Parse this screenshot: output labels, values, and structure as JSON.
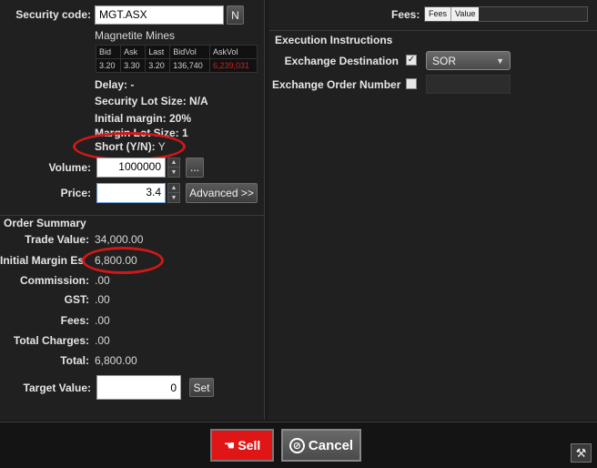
{
  "security": {
    "code_label": "Security code:",
    "code_value": "MGT.ASX",
    "n_button": "N",
    "name": "Magnetite Mines"
  },
  "market": {
    "headers": [
      "Bid",
      "Ask",
      "Last",
      "BidVol",
      "AskVol"
    ],
    "row": [
      "3.20",
      "3.30",
      "3.20",
      "136,740",
      "6,239,031"
    ],
    "askvol_color": "#d22020"
  },
  "info": {
    "delay": "Delay: -",
    "lot_size": "Security Lot Size: N/A",
    "initial_margin": "Initial margin: 20%",
    "margin_lot_size": "Margin Lot Size: 1",
    "short_label": "Short (Y/N):",
    "short_value": "Y"
  },
  "order": {
    "volume_label": "Volume:",
    "volume_value": "1000000",
    "ellipsis_button": "...",
    "price_label": "Price:",
    "price_value": "3.4",
    "advanced_button": "Advanced >>"
  },
  "summary": {
    "title": "Order Summary",
    "trade_value_label": "Trade Value:",
    "trade_value": "34,000.00",
    "initial_margin_label": "Initial Margin Es",
    "initial_margin_value": "6,800.00",
    "commission_label": "Commission:",
    "commission_value": ".00",
    "gst_label": "GST:",
    "gst_value": ".00",
    "fees_label": "Fees:",
    "fees_value": ".00",
    "total_charges_label": "Total Charges:",
    "total_charges_value": ".00",
    "total_label": "Total:",
    "total_value": "6,800.00",
    "target_label": "Target Value:",
    "target_value": "0",
    "set_button": "Set"
  },
  "right": {
    "fees_label": "Fees:",
    "fees_tab": "Fees",
    "value_tab": "Value",
    "exec_title": "Execution Instructions",
    "exchange_dest_label": "Exchange Destination",
    "exchange_dest_checked": true,
    "exchange_dest_value": "SOR",
    "exchange_order_label": "Exchange Order Number"
  },
  "actions": {
    "sell": "Sell",
    "cancel": "Cancel"
  },
  "colors": {
    "sell_bg": "#e01515",
    "annotation": "#d01818"
  }
}
